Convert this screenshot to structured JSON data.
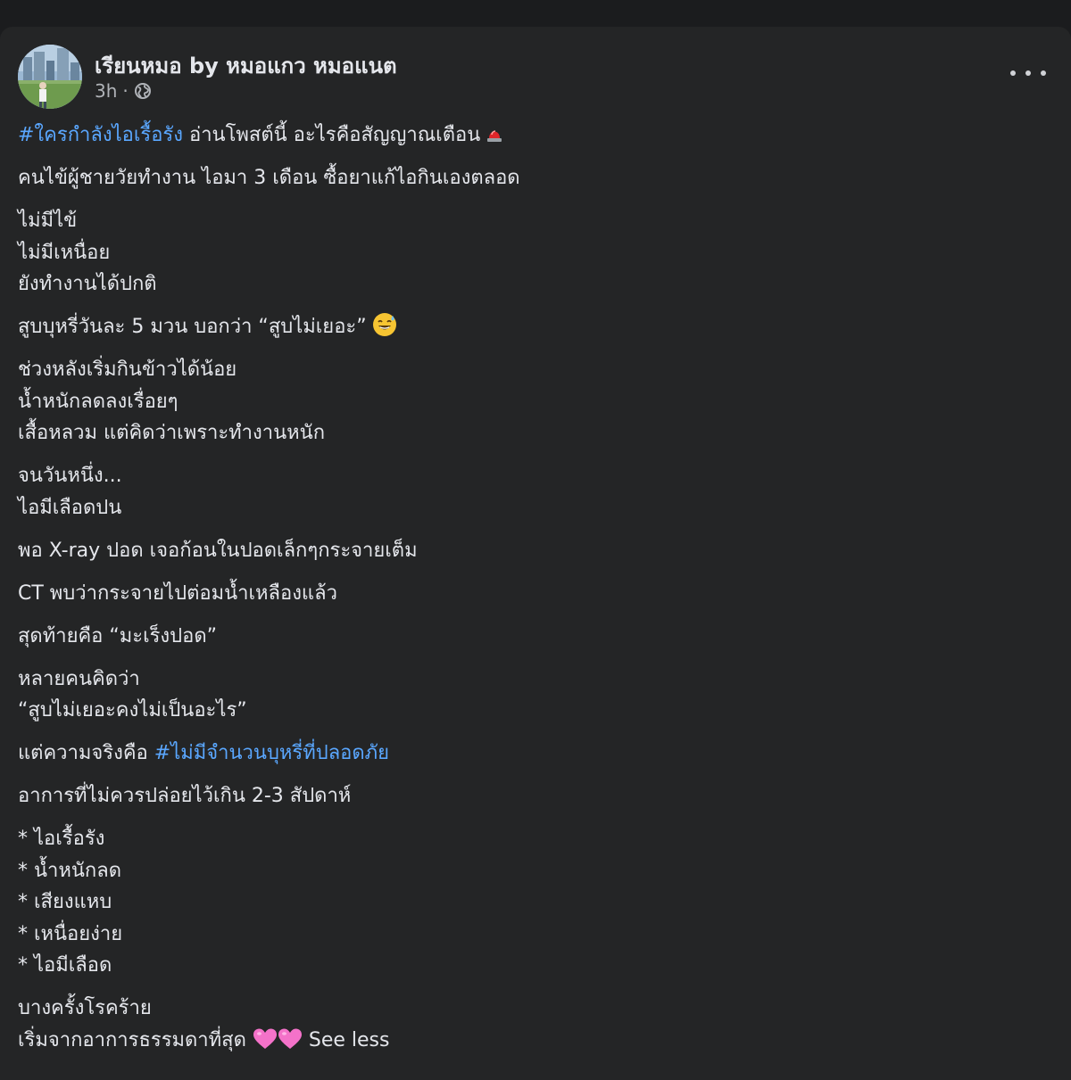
{
  "post": {
    "author": "เรียนหมอ by หมอแกว หมอแนต",
    "time": "3h",
    "separator": "·",
    "privacy_icon": "globe-icon",
    "more_icon": "more-options-icon",
    "hashtag_color": "#5aa7ff",
    "paragraphs": [
      [
        [
          {
            "text": "#ใครกำลังไอเรื้อรัง",
            "type": "hashtag"
          },
          {
            "text": " อ่านโพสต์นี้  อะไรคือสัญญาณเตือน",
            "type": "text"
          },
          {
            "icon": "siren-emoji",
            "type": "icon"
          }
        ]
      ],
      [
        [
          {
            "text": "คนไข้ผู้ชายวัยทำงาน ไอมา 3 เดือน ซื้อยาแก้ไอกินเองตลอด",
            "type": "text"
          }
        ]
      ],
      [
        [
          {
            "text": "ไม่มีไข้",
            "type": "text"
          }
        ],
        [
          {
            "text": "ไม่มีเหนื่อย",
            "type": "text"
          }
        ],
        [
          {
            "text": "ยังทำงานได้ปกติ",
            "type": "text"
          }
        ]
      ],
      [
        [
          {
            "text": "สูบบุหรี่วันละ 5 มวน บอกว่า “สูบไม่เยอะ”",
            "type": "text"
          },
          {
            "icon": "sweat-smile-emoji",
            "type": "icon"
          }
        ]
      ],
      [
        [
          {
            "text": "ช่วงหลังเริ่มกินข้าวได้น้อย",
            "type": "text"
          }
        ],
        [
          {
            "text": "น้ำหนักลดลงเรื่อยๆ",
            "type": "text"
          }
        ],
        [
          {
            "text": "เสื้อหลวม แต่คิดว่าเพราะทำงานหนัก",
            "type": "text"
          }
        ]
      ],
      [
        [
          {
            "text": "จนวันหนึ่ง...",
            "type": "text"
          }
        ],
        [
          {
            "text": "ไอมีเลือดปน",
            "type": "text"
          }
        ]
      ],
      [
        [
          {
            "text": "พอ X-ray ปอด เจอก้อนในปอดเล็กๆกระจายเต็ม",
            "type": "text"
          }
        ]
      ],
      [
        [
          {
            "text": "CT พบว่ากระจายไปต่อมน้ำเหลืองแล้ว",
            "type": "text"
          }
        ]
      ],
      [
        [
          {
            "text": "สุดท้ายคือ “มะเร็งปอด”",
            "type": "text"
          }
        ]
      ],
      [
        [
          {
            "text": "หลายคนคิดว่า",
            "type": "text"
          }
        ],
        [
          {
            "text": "“สูบไม่เยอะคงไม่เป็นอะไร”",
            "type": "text"
          }
        ]
      ],
      [
        [
          {
            "text": "แต่ความจริงคือ ",
            "type": "text"
          },
          {
            "text": "#ไม่มีจำนวนบุหรี่ที่ปลอดภัย",
            "type": "hashtag"
          }
        ]
      ],
      [
        [
          {
            "text": "อาการที่ไม่ควรปล่อยไว้เกิน 2-3 สัปดาห์",
            "type": "text"
          }
        ]
      ],
      [
        [
          {
            "text": "* ไอเรื้อรัง",
            "type": "text"
          }
        ],
        [
          {
            "text": "* น้ำหนักลด",
            "type": "text"
          }
        ],
        [
          {
            "text": "* เสียงแหบ",
            "type": "text"
          }
        ],
        [
          {
            "text": "* เหนื่อยง่าย",
            "type": "text"
          }
        ],
        [
          {
            "text": "* ไอมีเลือด",
            "type": "text"
          }
        ]
      ],
      [
        [
          {
            "text": "บางครั้งโรคร้าย",
            "type": "text"
          }
        ],
        [
          {
            "text": "เริ่มจากอาการธรรมดาที่สุด ",
            "type": "text"
          },
          {
            "icon": "pink-heart-emoji",
            "type": "icon"
          },
          {
            "icon": "pink-heart-emoji",
            "type": "icon"
          },
          {
            "text": " ",
            "type": "text"
          },
          {
            "text": "See less",
            "type": "link"
          }
        ]
      ]
    ]
  }
}
